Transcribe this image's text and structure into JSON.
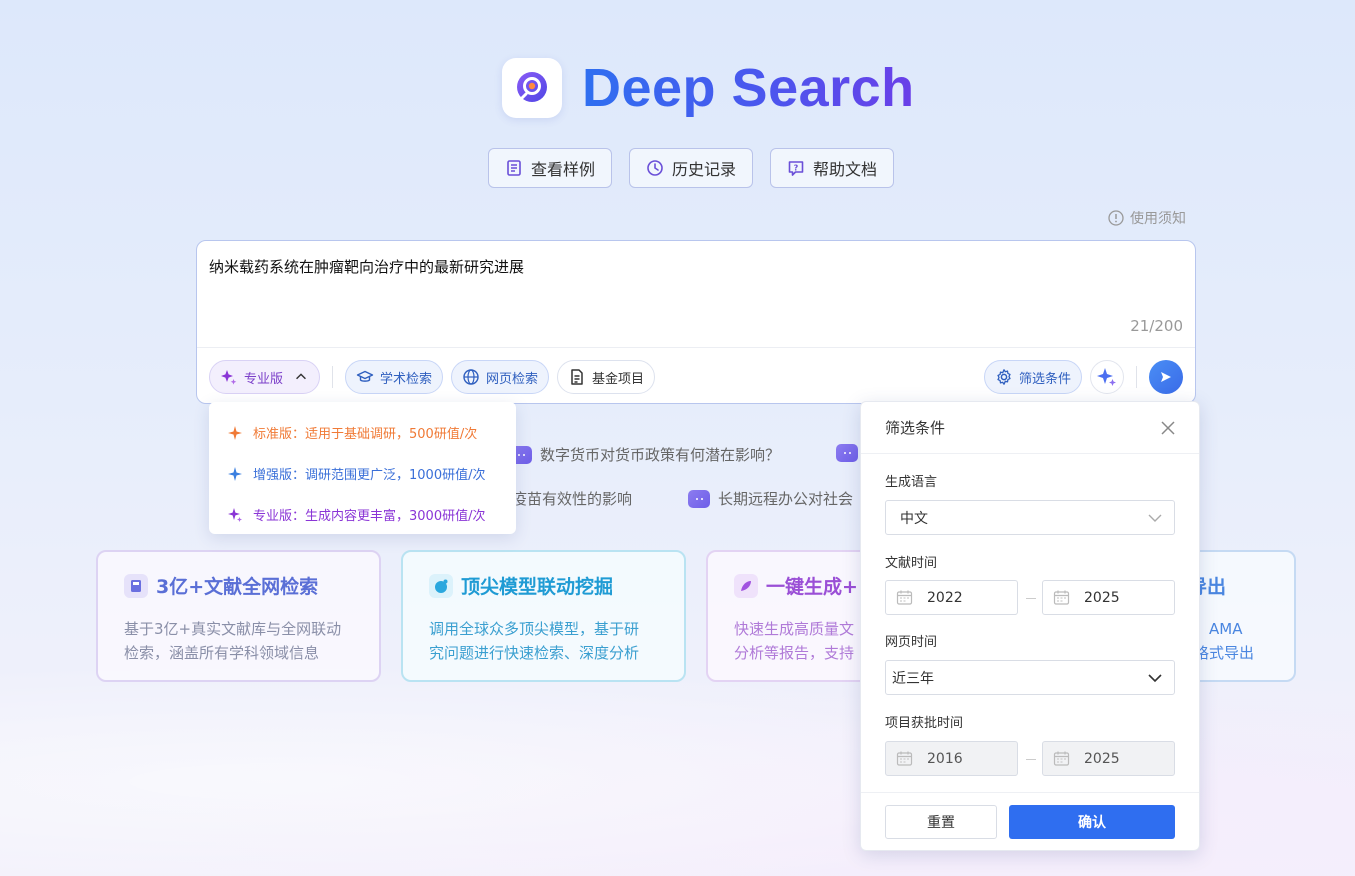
{
  "header": {
    "title": "Deep Search",
    "buttons": [
      {
        "label": "查看样例",
        "icon": "document-icon"
      },
      {
        "label": "历史记录",
        "icon": "clock-icon"
      },
      {
        "label": "帮助文档",
        "icon": "help-icon"
      }
    ],
    "notice": "使用须知"
  },
  "search": {
    "query": "纳米载药系统在肿瘤靶向治疗中的最新研究进展",
    "counter": "21/200",
    "toolbar": {
      "version": "专业版",
      "academic": "学术检索",
      "web": "网页检索",
      "fund": "基金项目",
      "filter": "筛选条件"
    }
  },
  "version_menu": {
    "items": [
      {
        "label": "标准版：适用于基础调研，500研值/次",
        "color": "#f07a36"
      },
      {
        "label": "增强版：调研范围更广泛，1000研值/次",
        "color": "#3a6fd8"
      },
      {
        "label": "专业版：生成内容更丰富，3000研值/次",
        "color": "#8a35d6"
      }
    ]
  },
  "suggestions": [
    {
      "text": "数字货币对货币政策有何潜在影响？"
    },
    {
      "text": "疫苗有效性的影响"
    },
    {
      "text": "长期远程办公对社会"
    }
  ],
  "cards": [
    {
      "title": "3亿+文献全网检索",
      "line1": "基于3亿+真实文献库与全网联动",
      "line2": "检索，涵盖所有学科领域信息",
      "color": "#5a6fd6"
    },
    {
      "title": "顶尖模型联动挖掘",
      "line1": "调用全球众多顶尖模型，基于研",
      "line2": "究问题进行快速检索、深度分析",
      "color": "#1f9bd4"
    },
    {
      "title": "一键生成+",
      "line1": "快速生成高质量文",
      "line2": "分析等报告，支持",
      "color": "#9a4fd6"
    },
    {
      "title": "导出",
      "line1": "、AMA",
      "line2": "格式导出",
      "color": "#4a86e0"
    }
  ],
  "filter_panel": {
    "title": "筛选条件",
    "language_label": "生成语言",
    "language_value": "中文",
    "lit_time_label": "文献时间",
    "lit_start": "2022",
    "lit_end": "2025",
    "web_time_label": "网页时间",
    "web_time_value": "近三年",
    "project_time_label": "项目获批时间",
    "project_start": "2016",
    "project_end": "2025",
    "reset": "重置",
    "confirm": "确认"
  }
}
